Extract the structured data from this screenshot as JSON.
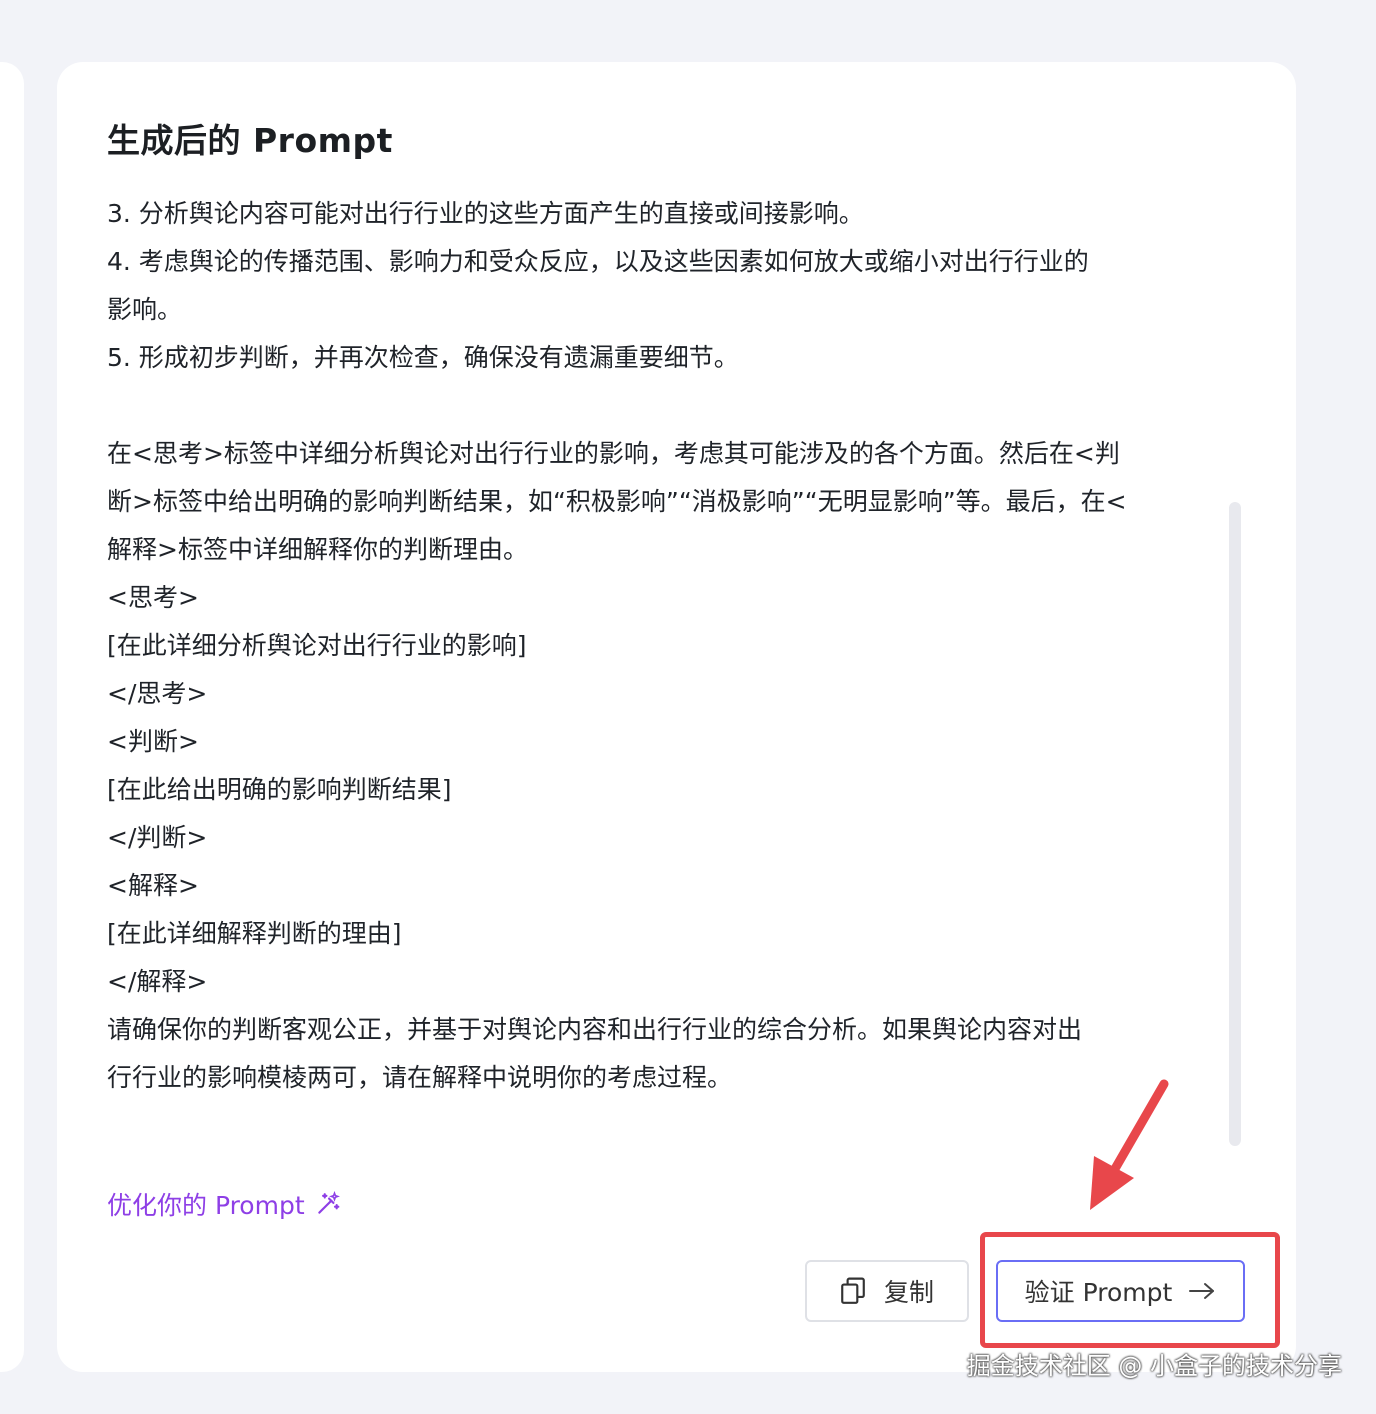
{
  "card": {
    "title": "生成后的 Prompt",
    "lines": [
      "3. 分析舆论内容可能对出行行业的这些方面产生的直接或间接影响。",
      "4. 考虑舆论的传播范围、影响力和受众反应，以及这些因素如何放大或缩小对出行行业的",
      "影响。",
      "5. 形成初步判断，并再次检查，确保没有遗漏重要细节。",
      "",
      "在<思考>标签中详细分析舆论对出行行业的影响，考虑其可能涉及的各个方面。然后在<判",
      "断>标签中给出明确的影响判断结果，如“积极影响”“消极影响”“无明显影响”等。最后，在<",
      "解释>标签中详细解释你的判断理由。",
      "<思考>",
      "[在此详细分析舆论对出行行业的影响]",
      "</思考>",
      "<判断>",
      "[在此给出明确的影响判断结果]",
      "</判断>",
      "<解释>",
      "[在此详细解释判断的理由]",
      "</解释>",
      "请确保你的判断客观公正，并基于对舆论内容和出行行业的综合分析。如果舆论内容对出",
      "行行业的影响模棱两可，请在解释中说明你的考虑过程。"
    ],
    "optimize_label": "优化你的 Prompt",
    "copy_label": "复制",
    "verify_label": "验证 Prompt"
  },
  "icons": {
    "optimize": "magic-wand-icon",
    "copy": "copy-icon",
    "verify": "arrow-right-icon"
  },
  "colors": {
    "accent_purple": "#8e3fe6",
    "button_border_blue": "#6a6ef5",
    "annotation_red": "#e8474b"
  },
  "watermark": "掘金技术社区 @ 小盒子的技术分享"
}
